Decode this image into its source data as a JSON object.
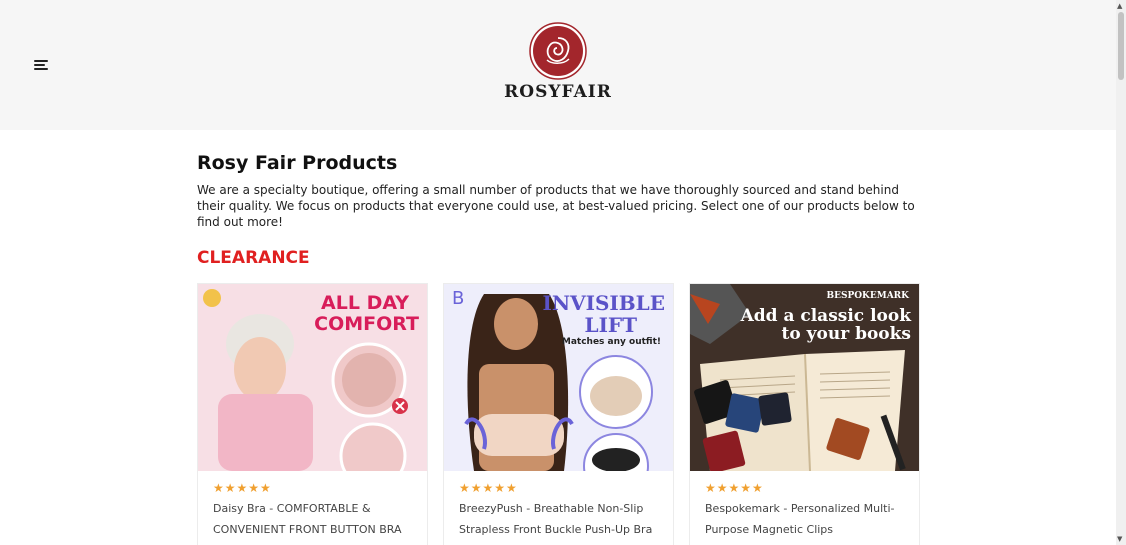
{
  "header": {
    "brand_name": "ROSYFAIR",
    "menu_icon": "hamburger-menu-icon"
  },
  "main": {
    "title": "Rosy Fair Products",
    "intro": "We are a specialty boutique, offering a small number of products that we have thoroughly sourced and stand behind their quality. We focus on products that everyone could use, at best-valued pricing. Select one of our products below to find out more!",
    "section_title": "CLEARANCE"
  },
  "products": [
    {
      "rating": 5,
      "stars": "★★★★★",
      "title": "Daisy Bra - COMFORTABLE & CONVENIENT FRONT BUTTON BRA",
      "image_text": [
        "ALL DAY",
        "COMFORT"
      ]
    },
    {
      "rating": 5,
      "stars": "★★★★★",
      "title": "BreezyPush - Breathable Non-Slip Strapless Front Buckle Push-Up Bra",
      "image_text": [
        "INVISIBLE",
        "LIFT",
        "Matches any outfit!"
      ],
      "image_badge": "B"
    },
    {
      "rating": 5,
      "stars": "★★★★★",
      "title": "Bespokemark - Personalized Multi-Purpose Magnetic Clips",
      "image_text": [
        "BESPOKEMARK",
        "Add a classic look",
        "to your books"
      ]
    }
  ],
  "colors": {
    "header_bg": "#f6f6f6",
    "brand_red": "#a3262c",
    "clearance_red": "#e02020",
    "star": "#f0a030"
  }
}
